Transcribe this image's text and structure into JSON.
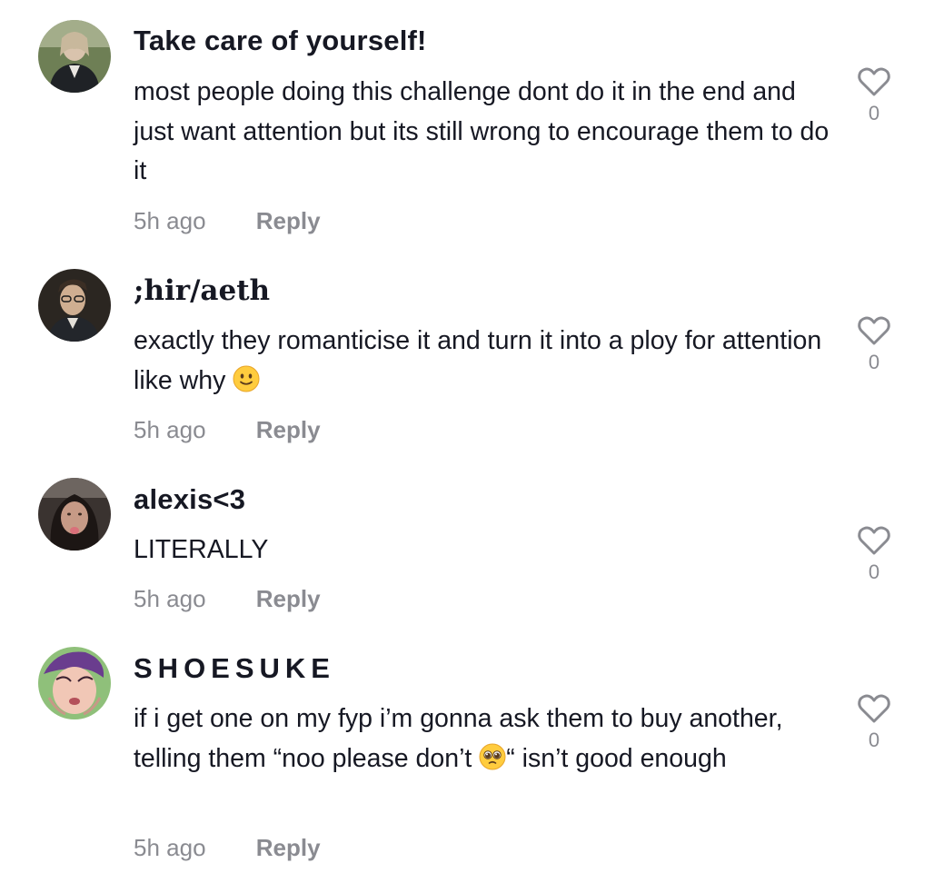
{
  "comments": [
    {
      "username": "Take care of yourself!",
      "text": "most people doing this challenge dont do it in the end and just want attention but its still wrong to encourage them to do it",
      "time": "5h ago",
      "reply_label": "Reply",
      "likes": "0"
    },
    {
      "username": ";hir/aeth",
      "text": "exactly they romanticise it and turn it into a ploy for attention like why",
      "emoji": "slightly-smiling-face",
      "time": "5h ago",
      "reply_label": "Reply",
      "likes": "0"
    },
    {
      "username": "alexis<3",
      "text": "LITERALLY",
      "time": "5h ago",
      "reply_label": "Reply",
      "likes": "0"
    },
    {
      "username": "SHOESUKE",
      "text_before_emoji": "if i get one on my fyp i’m gonna ask them to buy another, telling them “noo please don’t",
      "emoji": "pleading-face",
      "text_after_emoji": "“ isn’t good enough",
      "time": "5h ago",
      "reply_label": "Reply",
      "likes": "0"
    }
  ],
  "icons": {
    "like": "heart-outline-icon"
  },
  "colors": {
    "text": "#161823",
    "muted": "#8a8b91",
    "heart_outline": "#8a8b91"
  }
}
